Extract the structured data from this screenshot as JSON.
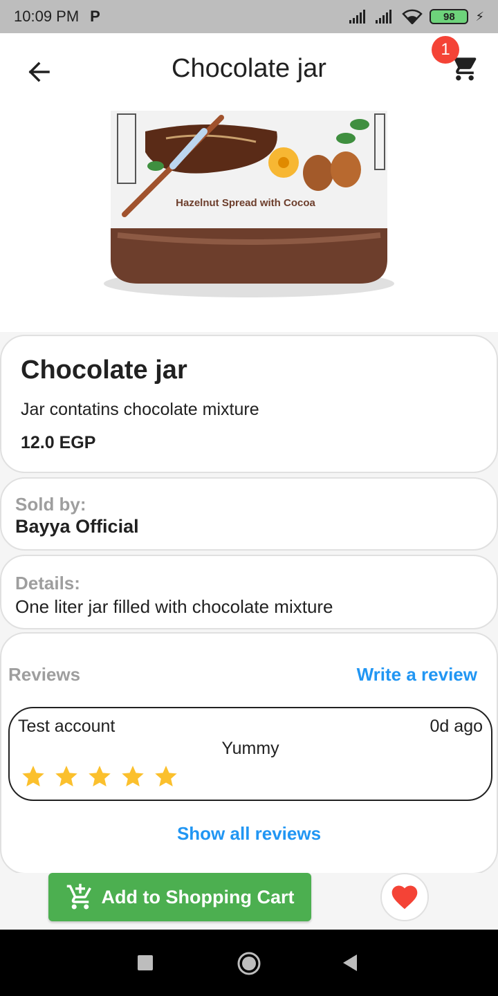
{
  "status_bar": {
    "time": "10:09 PM",
    "carrier_icon": "P",
    "battery": "98"
  },
  "app_bar": {
    "title": "Chocolate jar",
    "cart_badge": "1",
    "icons": [
      "arrow-back-icon",
      "shopping-cart-icon"
    ]
  },
  "product_image": {
    "label": "Hazelnut Spread with Cocoa"
  },
  "product": {
    "name": "Chocolate jar",
    "description": "Jar contatins chocolate mixture",
    "price": "12.0 EGP"
  },
  "seller": {
    "label": "Sold by:",
    "name": "Bayya Official"
  },
  "details": {
    "label": "Details:",
    "text": "One liter jar filled with chocolate mixture"
  },
  "reviews": {
    "title": "Reviews",
    "write_link": "Write a review",
    "items": [
      {
        "author": "Test account",
        "time": "0d ago",
        "text": "Yummy",
        "rating": 5
      }
    ],
    "show_all": "Show all reviews"
  },
  "actions": {
    "add_to_cart": "Add to Shopping Cart",
    "add_cart_color": "#4caf50",
    "favorite_color": "#f44336"
  },
  "colors": {
    "accent": "#2196f3",
    "badge": "#f44336",
    "star": "#fbc02d"
  }
}
